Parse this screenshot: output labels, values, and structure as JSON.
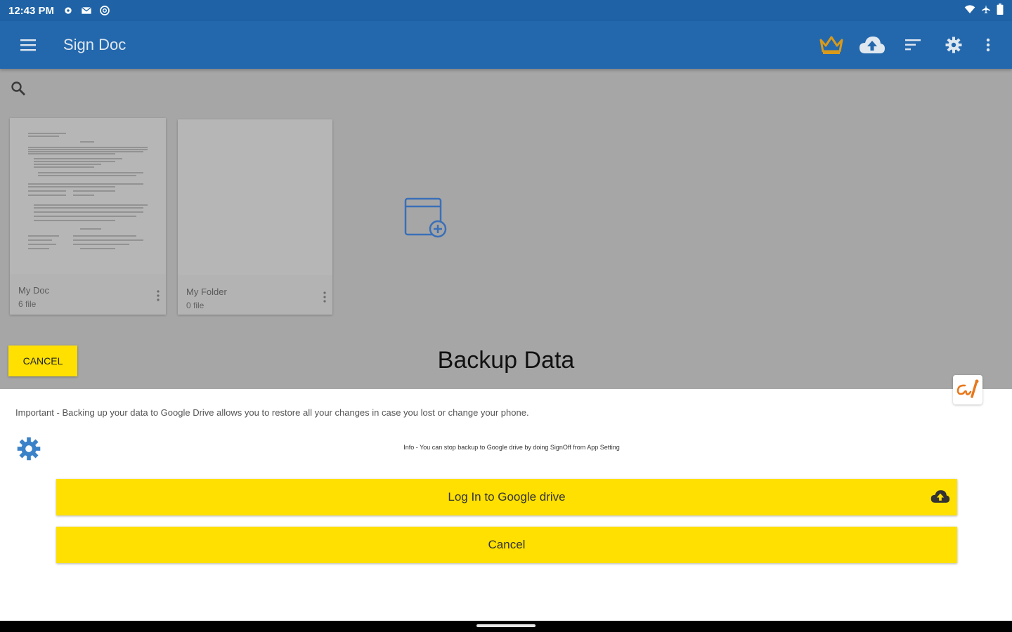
{
  "status_bar": {
    "time": "12:43 PM"
  },
  "app_bar": {
    "title": "Sign Doc",
    "icons": [
      "menu-icon",
      "crown-icon",
      "cloud-upload-icon",
      "sort-icon",
      "gear-icon",
      "more-vert-icon"
    ],
    "accent_color": "#2368ad"
  },
  "search": {
    "icon": "search-icon"
  },
  "folders": [
    {
      "name": "My Doc",
      "count": "6 file"
    },
    {
      "name": "My Folder",
      "count": "0 file"
    }
  ],
  "dialog": {
    "cancel_top_label": "CANCEL",
    "title": "Backup Data",
    "important_text": "Important - Backing up your data to Google Drive allows you to restore all your changes in case you lost or change your phone.",
    "info_text": "Info - You can stop backup to Google drive by doing SignOff from App Setting",
    "login_label": "Log In to Google drive",
    "cancel_label": "Cancel",
    "button_color": "#ffe000"
  }
}
